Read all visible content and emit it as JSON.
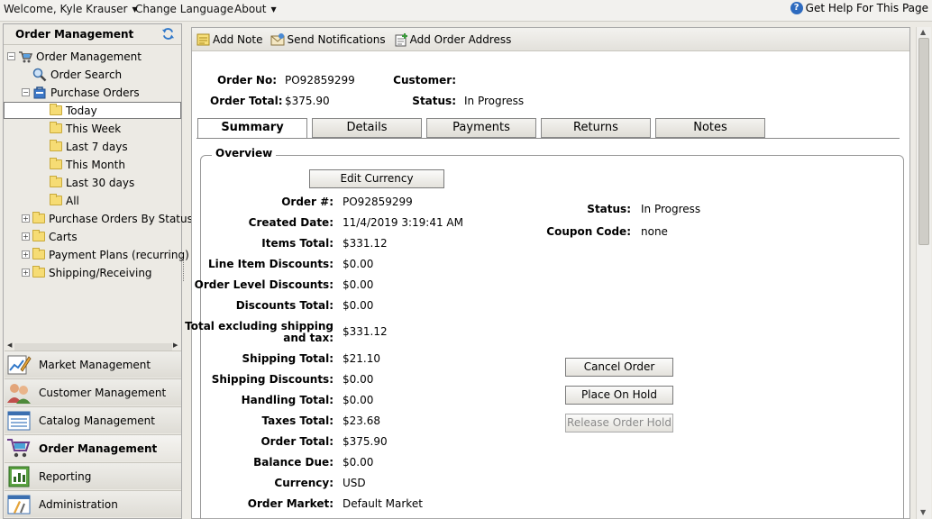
{
  "topbar": {
    "welcome": "Welcome, Kyle Krauser",
    "change_language": "Change Language",
    "about": "About",
    "help": "Get Help For This Page"
  },
  "left_panel": {
    "title": "Order Management",
    "tree": {
      "root": "Order Management",
      "order_search": "Order Search",
      "purchase_orders": "Purchase Orders",
      "today": "Today",
      "this_week": "This Week",
      "last_7_days": "Last 7 days",
      "this_month": "This Month",
      "last_30_days": "Last 30 days",
      "all": "All",
      "by_status": "Purchase Orders By Status",
      "carts": "Carts",
      "payment_plans": "Payment Plans (recurring)",
      "shipping": "Shipping/Receiving"
    },
    "modules": [
      "Market Management",
      "Customer Management",
      "Catalog Management",
      "Order Management",
      "Reporting",
      "Administration"
    ]
  },
  "toolbar": {
    "add_note": "Add Note",
    "send_notifications": "Send Notifications",
    "add_order_address": "Add Order Address"
  },
  "header": {
    "order_no_label": "Order No:",
    "order_no": "PO92859299",
    "order_total_label": "Order Total:",
    "order_total": "$375.90",
    "customer_label": "Customer:",
    "customer": "",
    "status_label": "Status:",
    "status": "In Progress"
  },
  "tabs": [
    "Summary",
    "Details",
    "Payments",
    "Returns",
    "Notes"
  ],
  "overview": {
    "legend": "Overview",
    "edit_currency": "Edit Currency",
    "fields": [
      {
        "label": "Order #:",
        "value": "PO92859299"
      },
      {
        "label": "Created Date:",
        "value": "11/4/2019 3:19:41 AM"
      },
      {
        "label": "Items Total:",
        "value": "$331.12"
      },
      {
        "label": "Line Item Discounts:",
        "value": "$0.00"
      },
      {
        "label": "Order Level Discounts:",
        "value": "$0.00"
      },
      {
        "label": "Discounts Total:",
        "value": "$0.00"
      },
      {
        "label": "Total excluding shipping",
        "label2": "and tax:",
        "value": "$331.12"
      },
      {
        "label": "Shipping Total:",
        "value": "$21.10"
      },
      {
        "label": "Shipping Discounts:",
        "value": "$0.00"
      },
      {
        "label": "Handling Total:",
        "value": "$0.00"
      },
      {
        "label": "Taxes Total:",
        "value": "$23.68"
      },
      {
        "label": "Order Total:",
        "value": "$375.90"
      },
      {
        "label": "Balance Due:",
        "value": "$0.00"
      },
      {
        "label": "Currency:",
        "value": "USD"
      },
      {
        "label": "Order Market:",
        "value": "Default Market"
      }
    ],
    "status_label": "Status:",
    "status": "In Progress",
    "coupon_label": "Coupon Code:",
    "coupon": "none",
    "cancel_order": "Cancel Order",
    "place_on_hold": "Place On Hold",
    "release_order_hold": "Release Order Hold"
  }
}
